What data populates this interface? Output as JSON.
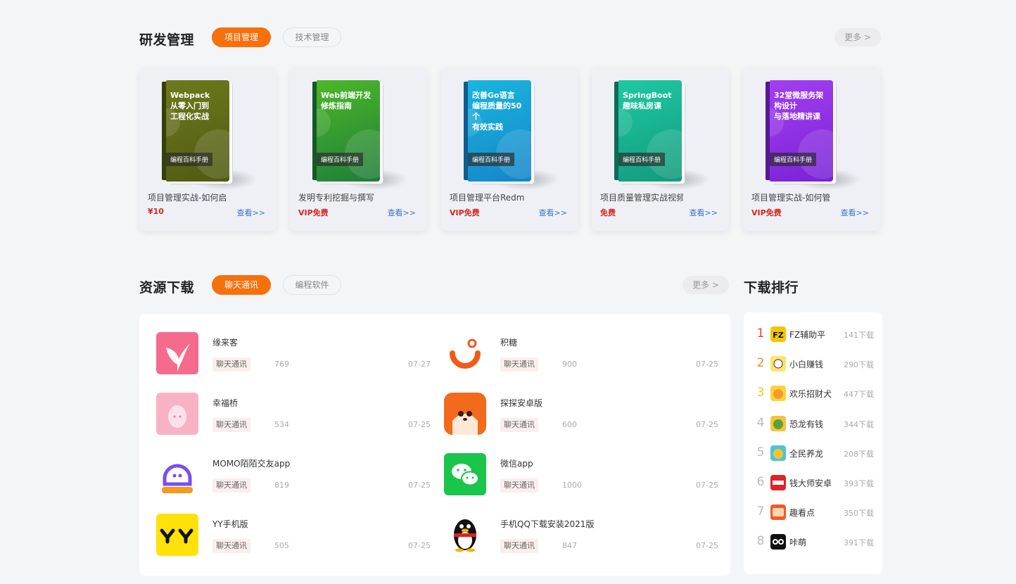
{
  "rd": {
    "title": "研发管理",
    "tabs": [
      "项目管理",
      "技术管理"
    ],
    "more": "更多 >",
    "books": [
      {
        "cover_title": "Webpack\n从零入门到\n工程化实战",
        "tag": "编程百科手册",
        "name": "项目管理实战-如何启",
        "price": "¥10",
        "view": "查看>>",
        "color": "#6e7a1c",
        "color2": "#4f5a12"
      },
      {
        "cover_title": "Web前端开发\n修炼指南",
        "tag": "编程百科手册",
        "name": "发明专利挖掘与撰写",
        "price": "VIP免费",
        "view": "查看>>",
        "color": "#4cb828",
        "color2": "#1f7d3a"
      },
      {
        "cover_title": "改善Go语言\n编程质量的50个\n有效实践",
        "tag": "编程百科手册",
        "name": "项目管理平台Redm",
        "price": "VIP免费",
        "view": "查看>>",
        "color": "#19b6de",
        "color2": "#1685c9"
      },
      {
        "cover_title": "SpringBoot\n趣味私房课",
        "tag": "编程百科手册",
        "name": "项目质量管理实战视频",
        "price": "免费",
        "view": "查看>>",
        "color": "#1fc9a2",
        "color2": "#129a7c"
      },
      {
        "cover_title": "32堂微服务架构设计\n与落地精讲课",
        "tag": "编程百科手册",
        "name": "项目管理实战-如何管",
        "price": "VIP免费",
        "view": "查看>>",
        "color": "#a23ff0",
        "color2": "#7a22d6"
      }
    ]
  },
  "res": {
    "title": "资源下载",
    "tabs": [
      "聊天通讯",
      "编程软件"
    ],
    "more": "更多 >",
    "items": [
      {
        "name": "缘来客",
        "cat": "聊天通讯",
        "num": "769",
        "date": "07-27",
        "icon": "hummingbird-icon"
      },
      {
        "name": "积糖",
        "cat": "聊天通讯",
        "num": "900",
        "date": "07-25",
        "icon": "jitang-logo-icon"
      },
      {
        "name": "幸福桥",
        "cat": "聊天通讯",
        "num": "534",
        "date": "07-25",
        "icon": "egg-icon"
      },
      {
        "name": "探探安卓版",
        "cat": "聊天通讯",
        "num": "600",
        "date": "07-25",
        "icon": "fox-icon"
      },
      {
        "name": "MOMO陌陌交友app",
        "cat": "聊天通讯",
        "num": "819",
        "date": "07-25",
        "icon": "momo-icon"
      },
      {
        "name": "微信app",
        "cat": "聊天通讯",
        "num": "1000",
        "date": "07-25",
        "icon": "wechat-icon"
      },
      {
        "name": "YY手机版",
        "cat": "聊天通讯",
        "num": "505",
        "date": "07-25",
        "icon": "yy-icon"
      },
      {
        "name": "手机QQ下载安装2021版",
        "cat": "聊天通讯",
        "num": "847",
        "date": "07-25",
        "icon": "qq-penguin-icon"
      }
    ]
  },
  "rank": {
    "title": "下载排行",
    "items": [
      {
        "no": "1",
        "name": "FZ辅助平",
        "dl": "141下载",
        "color": "#e8452c"
      },
      {
        "no": "2",
        "name": "小白赚钱",
        "dl": "290下载",
        "color": "#f08c2c"
      },
      {
        "no": "3",
        "name": "欢乐招财犬",
        "dl": "447下载",
        "color": "#f2c12e"
      },
      {
        "no": "4",
        "name": "恐龙有钱",
        "dl": "344下载",
        "color": "#bbbbbb"
      },
      {
        "no": "5",
        "name": "全民养龙",
        "dl": "208下载",
        "color": "#bbbbbb"
      },
      {
        "no": "6",
        "name": "钱大师安卓",
        "dl": "393下载",
        "color": "#bbbbbb"
      },
      {
        "no": "7",
        "name": "趣看点",
        "dl": "350下载",
        "color": "#bbbbbb"
      },
      {
        "no": "8",
        "name": "咔萌",
        "dl": "391下载",
        "color": "#bbbbbb"
      }
    ],
    "fz_logo_text": "FZ"
  }
}
